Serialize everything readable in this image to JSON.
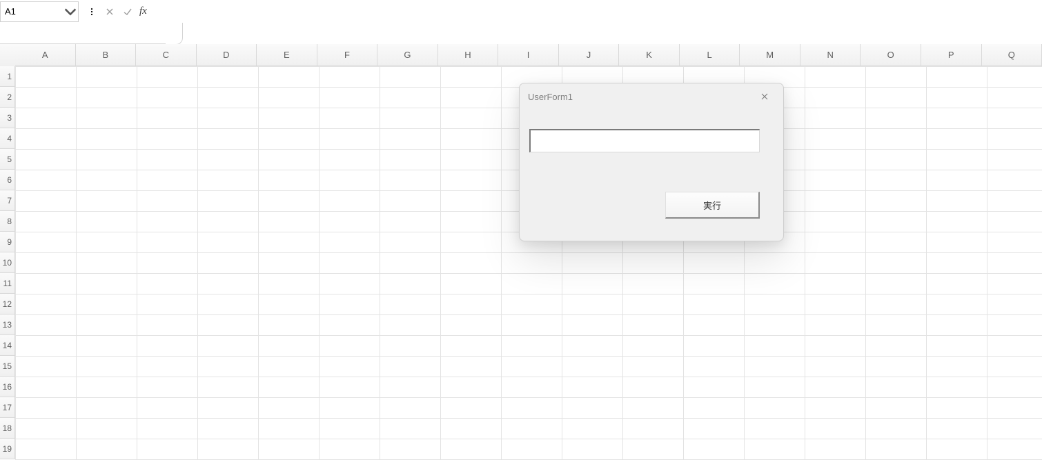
{
  "formula_bar": {
    "name_box_value": "A1",
    "formula_value": ""
  },
  "grid": {
    "columns": [
      "A",
      "B",
      "C",
      "D",
      "E",
      "F",
      "G",
      "H",
      "I",
      "J",
      "K",
      "L",
      "M",
      "N",
      "O",
      "P",
      "Q"
    ],
    "rows": [
      "1",
      "2",
      "3",
      "4",
      "5",
      "6",
      "7",
      "8",
      "9",
      "10",
      "11",
      "12",
      "13",
      "14",
      "15",
      "16",
      "17",
      "18",
      "19"
    ]
  },
  "userform": {
    "title": "UserForm1",
    "textbox_value": "",
    "button_label": "実行"
  }
}
